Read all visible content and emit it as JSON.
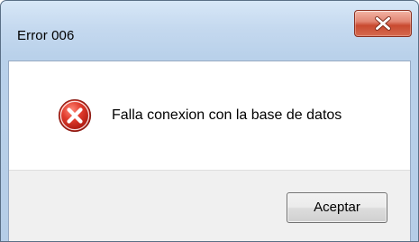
{
  "window": {
    "title": "Error 006"
  },
  "dialog": {
    "icon": "error-icon",
    "message": "Falla conexion con la base de datos",
    "ok_label": "Aceptar"
  },
  "controls": {
    "close_icon": "close-icon"
  },
  "colors": {
    "close_button": "#c94a30",
    "error_icon": "#c8231a",
    "content_background": "#ffffff",
    "button_bar_background": "#f0f0f0",
    "frame": "#b9d1ea"
  }
}
